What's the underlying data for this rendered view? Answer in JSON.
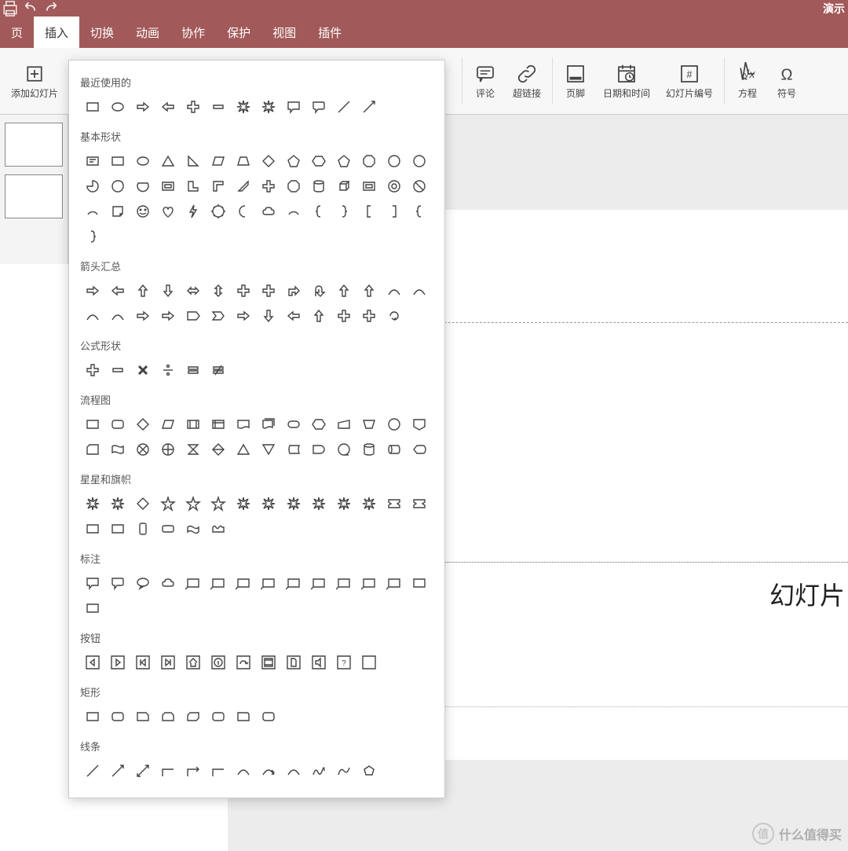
{
  "title_right": "演示",
  "tabs": [
    {
      "label": "页",
      "active": false
    },
    {
      "label": "插入",
      "active": true
    },
    {
      "label": "切换",
      "active": false
    },
    {
      "label": "动画",
      "active": false
    },
    {
      "label": "协作",
      "active": false
    },
    {
      "label": "保护",
      "active": false
    },
    {
      "label": "视图",
      "active": false
    },
    {
      "label": "插件",
      "active": false
    }
  ],
  "ribbon": {
    "add_slide": "添加幻灯片",
    "comment": "评论",
    "hyperlink": "超链接",
    "footer": "页脚",
    "datetime": "日期和时间",
    "slide_number": "幻灯片编号",
    "equation": "方程",
    "symbol": "符号"
  },
  "slide_text": "幻灯片",
  "watermark": {
    "icon": "值",
    "text": "什么值得买"
  },
  "shape_panel": {
    "sections": [
      {
        "title": "最近使用的",
        "shapes": [
          "rect",
          "ellipse",
          "arrow-right",
          "arrow-left",
          "plus",
          "minus",
          "burst",
          "burst2",
          "speech-rect",
          "speech-round",
          "line",
          "line-arrow"
        ]
      },
      {
        "title": "基本形状",
        "shapes": [
          "text-box",
          "rect",
          "ellipse",
          "triangle",
          "right-triangle",
          "parallelogram",
          "trapezoid",
          "diamond",
          "pentagon",
          "hexagon",
          "heptagon",
          "octagon",
          "decagon",
          "dodecagon",
          "pie",
          "tear",
          "chord",
          "frame",
          "l-shape",
          "l-shape2",
          "diag-stripe",
          "plus",
          "plaque",
          "can",
          "cube",
          "bevel",
          "donut",
          "no-symbol",
          "arc",
          "folded-corner",
          "smiley",
          "heart",
          "lightning",
          "sun",
          "moon",
          "cloud",
          "bracket-arc",
          "brace-left",
          "brace-right",
          "brace-left2",
          "brace-right2",
          "brace-left3",
          "brace-right3"
        ]
      },
      {
        "title": "箭头汇总",
        "shapes": [
          "arrow-right",
          "arrow-left",
          "arrow-up",
          "arrow-down",
          "arrow-leftright",
          "arrow-updown",
          "arrow-quad",
          "arrow-triple",
          "arrow-bent",
          "arrow-uturn",
          "arrow-leftup",
          "arrow-bentup",
          "arrow-curveright",
          "arrow-curveleft",
          "arrow-curveup",
          "arrow-curvedown",
          "arrow-stripe",
          "arrow-notch",
          "arrow-pentagon",
          "arrow-chevron",
          "arrow-rightcallout",
          "arrow-downcallout",
          "arrow-leftcallout",
          "arrow-upcallout",
          "arrow-leftrightcallout",
          "arrow-quadcallout",
          "arrow-circular"
        ]
      },
      {
        "title": "公式形状",
        "shapes": [
          "math-plus",
          "math-minus",
          "math-multiply",
          "math-divide",
          "math-equal",
          "math-notequal"
        ]
      },
      {
        "title": "流程图",
        "shapes": [
          "fc-process",
          "fc-altprocess",
          "fc-decision",
          "fc-data",
          "fc-predefined",
          "fc-internal",
          "fc-document",
          "fc-multidoc",
          "fc-terminator",
          "fc-preparation",
          "fc-manual-input",
          "fc-manual-op",
          "fc-connector",
          "fc-offpage",
          "fc-card",
          "fc-tape",
          "fc-summing",
          "fc-or",
          "fc-collate",
          "fc-sort",
          "fc-extract",
          "fc-merge",
          "fc-stored",
          "fc-delay",
          "fc-seq-storage",
          "fc-magnetic",
          "fc-direct",
          "fc-display"
        ]
      },
      {
        "title": "星星和旗帜",
        "shapes": [
          "explosion1",
          "explosion2",
          "star4",
          "star5",
          "star6",
          "star7",
          "star8",
          "star10",
          "star12",
          "star16",
          "star24",
          "star32",
          "ribbon-up",
          "ribbon-down",
          "ribbon2-up",
          "ribbon2-down",
          "vertical-scroll",
          "horizontal-scroll",
          "wave",
          "double-wave"
        ]
      },
      {
        "title": "标注",
        "shapes": [
          "callout-rect",
          "callout-round",
          "callout-oval",
          "callout-cloud",
          "callout-line1",
          "callout-line2",
          "callout-line3",
          "callout-accent1",
          "callout-accent2",
          "callout-accent3",
          "callout-border1",
          "callout-border2",
          "callout-border3",
          "callout-bar1",
          "callout-bar2"
        ]
      },
      {
        "title": "按钮",
        "shapes": [
          "btn-back",
          "btn-forward",
          "btn-begin",
          "btn-end",
          "btn-home",
          "btn-info",
          "btn-return",
          "btn-movie",
          "btn-document",
          "btn-sound",
          "btn-help",
          "btn-blank"
        ]
      },
      {
        "title": "矩形",
        "shapes": [
          "rect",
          "rect-round",
          "rect-snip1",
          "rect-snip2-same",
          "rect-snip2-diag",
          "rect-sniproundsame",
          "rect-round1",
          "rect-round2-same"
        ]
      },
      {
        "title": "线条",
        "shapes": [
          "line",
          "line-arrow",
          "line-double",
          "line-elbow",
          "line-elbow-arrow",
          "line-elbow-double",
          "curve",
          "curve-arrow",
          "curve-double",
          "scribble",
          "freeform",
          "freeform-closed"
        ]
      }
    ]
  }
}
